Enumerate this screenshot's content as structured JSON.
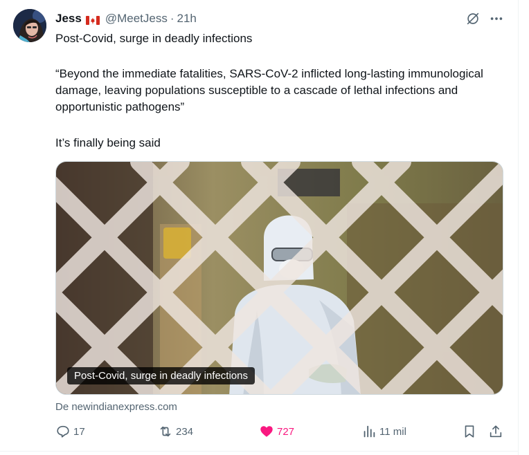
{
  "tweet": {
    "author_name": "Jess",
    "flag": "canada-flag-icon",
    "handle": "@MeetJess",
    "separator": "·",
    "time": "21h",
    "headline": "Post-Covid, surge in deadly infections",
    "quote": "“Beyond the immediate fatalities, SARS-CoV-2 inflicted long-lasting immunological damage, leaving populations susceptible to a cascade of lethal infections and opportunistic pathogens”",
    "closing": "It’s finally being said"
  },
  "media": {
    "caption": "Post-Covid, surge in deadly infections",
    "source": "De newindianexpress.com"
  },
  "actions": {
    "reply_count": "17",
    "retweet_count": "234",
    "like_count": "727",
    "views_count": "11 mil"
  },
  "colors": {
    "like": "#f91880",
    "muted": "#536471",
    "text": "#0f1419"
  }
}
